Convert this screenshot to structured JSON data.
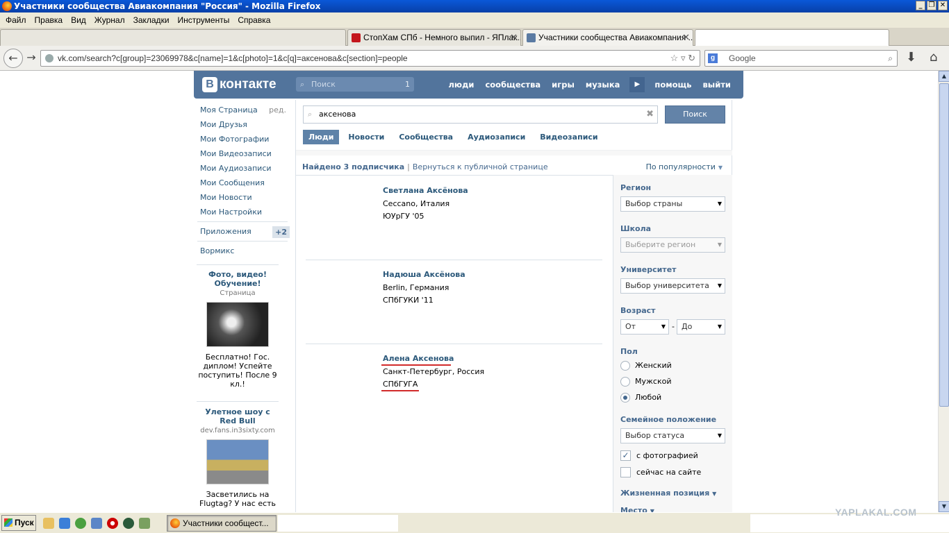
{
  "window": {
    "title": "Участники сообщества Авиакомпания \"Россия\" - Mozilla Firefox"
  },
  "menu": [
    "Файл",
    "Правка",
    "Вид",
    "Журнал",
    "Закладки",
    "Инструменты",
    "Справка"
  ],
  "tabs": [
    {
      "label": "СтопХам СПб - Немного выпил - ЯПлак...",
      "icon_color": "#c4161c"
    },
    {
      "label": "Участники сообщества Авиакомпания ...",
      "icon_color": "#5b7ba3"
    }
  ],
  "nav": {
    "url": "vk.com/search?c[group]=23069978&c[name]=1&c[photo]=1&c[q]=аксенова&c[section]=people",
    "search_engine": "Google"
  },
  "vk": {
    "logo": "контакте",
    "logo_b": "В",
    "header_search_placeholder": "Поиск",
    "header_search_count": "1",
    "nav_items": [
      "люди",
      "сообщества",
      "игры",
      "музыка",
      "помощь",
      "выйти"
    ],
    "left_menu": [
      "Моя Страница",
      "Мои Друзья",
      "Мои Фотографии",
      "Мои Видеозаписи",
      "Мои Аудиозаписи",
      "Мои Сообщения",
      "Мои Новости",
      "Мои Настройки"
    ],
    "edit_label": "ред.",
    "apps_label": "Приложения",
    "apps_badge": "+2",
    "wormix_label": "Вормикс",
    "ads": [
      {
        "title": "Фото, видео! Обучение!",
        "sub": "Страница",
        "desc": "Бесплатно! Гос. диплом! Успейте поступить! После 9 кл.!"
      },
      {
        "title": "Улетное шоу с Red Bull",
        "sub": "dev.fans.in3sixty.com",
        "desc": "Засветились на Flugtag? У нас есть"
      }
    ],
    "query": "аксенова",
    "search_button": "Поиск",
    "section_tabs": [
      "Люди",
      "Новости",
      "Сообщества",
      "Аудиозаписи",
      "Видеозаписи"
    ],
    "summary": "Найдено 3 подписчика",
    "return_link": "Вернуться к публичной странице",
    "sort_label": "По популярности",
    "results": [
      {
        "name": "Светлана Аксёнова",
        "line1": "Ceccano, Италия",
        "line2": "ЮУрГУ '05"
      },
      {
        "name": "Надюша Аксёнова",
        "line1": "Berlin, Германия",
        "line2": "СПбГУКИ '11"
      },
      {
        "name": "Алена Аксенова",
        "line1": "Санкт-Петербург, Россия",
        "line2": "СПбГУГА"
      }
    ],
    "filters": {
      "region_h": "Регион",
      "region_sel": "Выбор страны",
      "school_h": "Школа",
      "school_sel": "Выберите регион",
      "univ_h": "Университет",
      "univ_sel": "Выбор университета",
      "age_h": "Возраст",
      "age_from": "От",
      "age_dash": "-",
      "age_to": "До",
      "sex_h": "Пол",
      "sex_options": [
        "Женский",
        "Мужской",
        "Любой"
      ],
      "sex_selected": "Любой",
      "status_h": "Семейное положение",
      "status_sel": "Выбор статуса",
      "with_photo": "с фотографией",
      "with_photo_checked": true,
      "online": "сейчас на сайте",
      "online_checked": false,
      "life_h": "Жизненная позиция",
      "place_h": "Место"
    }
  },
  "taskbar": {
    "start": "Пуск",
    "task": "Участники сообщест..."
  },
  "watermark": "YAPLAKAL.COM"
}
